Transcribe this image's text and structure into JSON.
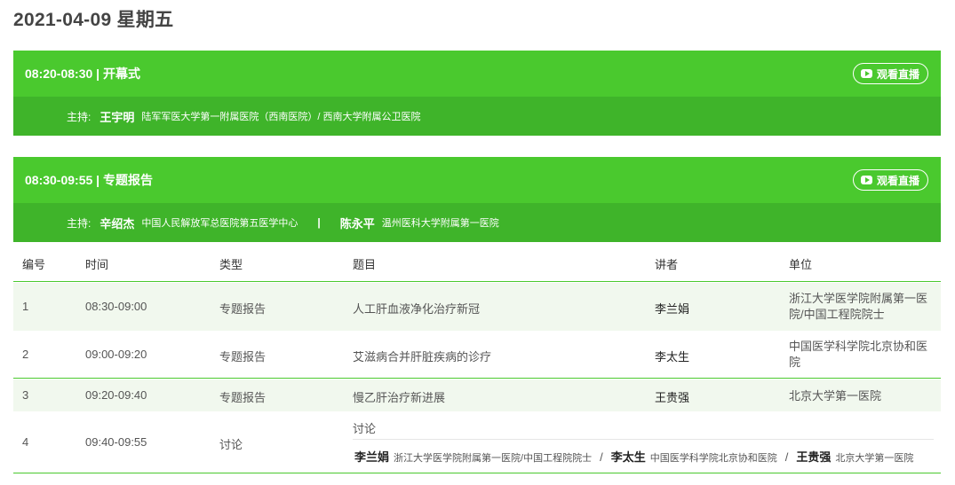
{
  "date_title": "2021-04-09 星期五",
  "colors": {
    "accent": "#4ac92e",
    "accent_dark": "#3fb42a",
    "row_alt": "#f1f8ee"
  },
  "watch_icon": "play-icon",
  "sessions": [
    {
      "time": "08:20-08:30 | 开幕式",
      "watch_label": "观看直播",
      "host_label": "主持:",
      "hosts": [
        {
          "name": "王宇明",
          "org": "陆军军医大学第一附属医院（西南医院）/ 西南大学附属公卫医院"
        }
      ]
    },
    {
      "time": "08:30-09:55 | 专题报告",
      "watch_label": "观看直播",
      "host_label": "主持:",
      "host_sep": "|",
      "hosts": [
        {
          "name": "辛绍杰",
          "org": "中国人民解放军总医院第五医学中心"
        },
        {
          "name": "陈永平",
          "org": "温州医科大学附属第一医院"
        }
      ]
    }
  ],
  "table": {
    "headers": [
      "编号",
      "时间",
      "类型",
      "题目",
      "讲者",
      "单位"
    ],
    "rows": [
      {
        "no": "1",
        "time": "08:30-09:00",
        "type": "专题报告",
        "title": "人工肝血液净化治疗新冠",
        "speaker": "李兰娟",
        "unit_lines": [
          "浙江大学医学院附属第一医",
          "院/中国工程院院士"
        ]
      },
      {
        "no": "2",
        "time": "09:00-09:20",
        "type": "专题报告",
        "title": "艾滋病合并肝脏疾病的诊疗",
        "speaker": "李太生",
        "unit_lines": [
          "中国医学科学院北京协和医",
          "院"
        ]
      },
      {
        "no": "3",
        "time": "09:20-09:40",
        "type": "专题报告",
        "title": "慢乙肝治疗新进展",
        "speaker": "王贵强",
        "unit_lines": [
          "北京大学第一医院"
        ]
      },
      {
        "no": "4",
        "time": "09:40-09:55",
        "type": "讨论",
        "title": "讨论",
        "separator": "/",
        "panelists": [
          {
            "name": "李兰娟",
            "org": "浙江大学医学院附属第一医院/中国工程院院士"
          },
          {
            "name": "李太生",
            "org": "中国医学科学院北京协和医院"
          },
          {
            "name": "王贵强",
            "org": "北京大学第一医院"
          }
        ]
      }
    ]
  }
}
